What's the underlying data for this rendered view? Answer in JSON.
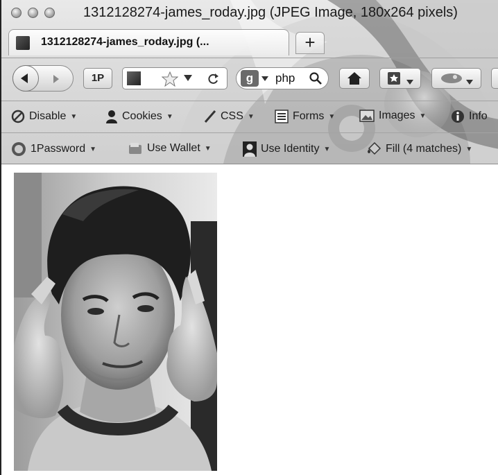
{
  "window": {
    "title": "1312128274-james_roday.jpg (JPEG Image, 180x264 pixels)"
  },
  "tabs": [
    {
      "label": "1312128274-james_roday.jpg (..."
    }
  ],
  "new_tab_label": "+",
  "navigation": {
    "onepassword_label": "1P",
    "search_engine_icon": "google-icon",
    "search_value": "php"
  },
  "web_developer_toolbar": {
    "items": [
      {
        "label": "Disable",
        "icon": "disable-icon"
      },
      {
        "label": "Cookies",
        "icon": "cookies-icon"
      },
      {
        "label": "CSS",
        "icon": "css-icon"
      },
      {
        "label": "Forms",
        "icon": "forms-icon"
      },
      {
        "label": "Images",
        "icon": "images-icon"
      },
      {
        "label": "Info",
        "icon": "info-icon"
      }
    ]
  },
  "onepassword_toolbar": {
    "items": [
      {
        "label": "1Password",
        "icon": "onepassword-icon"
      },
      {
        "label": "Use Wallet",
        "icon": "wallet-icon"
      },
      {
        "label": "Use Identity",
        "icon": "identity-icon"
      },
      {
        "label": "Fill (4 matches)",
        "icon": "fill-icon"
      }
    ]
  },
  "content": {
    "image_subject": "black-and-white portrait photo"
  }
}
